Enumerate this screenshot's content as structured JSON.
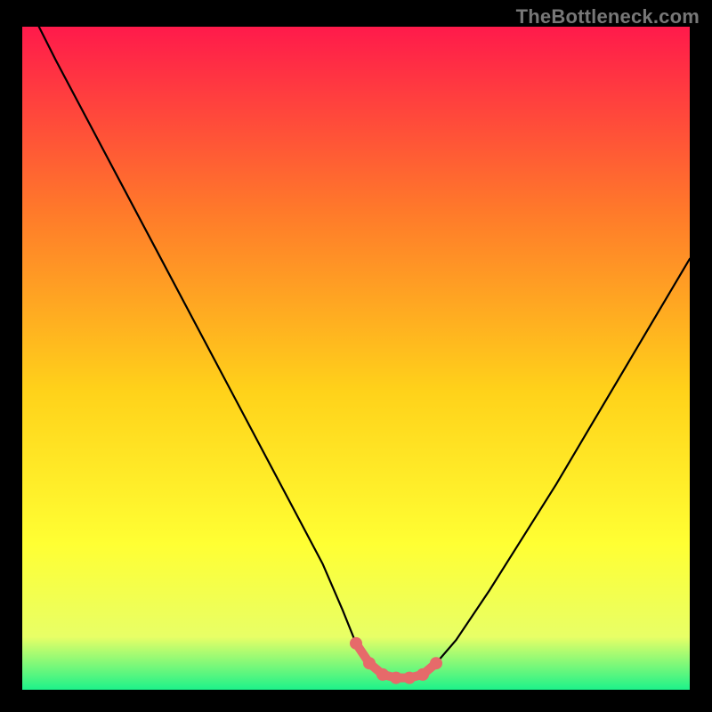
{
  "attribution": "TheBottleneck.com",
  "colors": {
    "black": "#000000",
    "attribution_text": "#777777",
    "gradient_top": "#ff1a4b",
    "gradient_mid_upper": "#ff7a2a",
    "gradient_mid": "#ffd21a",
    "gradient_mid_lower": "#ffff33",
    "gradient_lower": "#e8ff66",
    "gradient_bottom": "#1df28a",
    "curve_stroke": "#000000",
    "marker_fill": "#e66a6a"
  },
  "chart_data": {
    "type": "line",
    "title": "",
    "xlabel": "",
    "ylabel": "",
    "xlim": [
      0,
      100
    ],
    "ylim": [
      0,
      100
    ],
    "series": [
      {
        "name": "bottleneck-curve",
        "x": [
          0,
          5,
          10,
          15,
          20,
          25,
          30,
          35,
          40,
          45,
          48,
          50,
          52,
          54,
          56,
          58,
          60,
          62,
          65,
          70,
          75,
          80,
          85,
          90,
          95,
          100
        ],
        "values": [
          105,
          95,
          85.5,
          76,
          66.5,
          57,
          47.5,
          38,
          28.5,
          19,
          12,
          7,
          4,
          2.3,
          1.8,
          1.8,
          2.3,
          4,
          7.5,
          15,
          23,
          31,
          39.5,
          48,
          56.5,
          65
        ]
      }
    ],
    "markers": {
      "name": "bottleneck-range",
      "x": [
        50,
        52,
        54,
        56,
        58,
        60,
        62
      ],
      "values": [
        7,
        4,
        2.3,
        1.8,
        1.8,
        2.3,
        4
      ]
    }
  }
}
